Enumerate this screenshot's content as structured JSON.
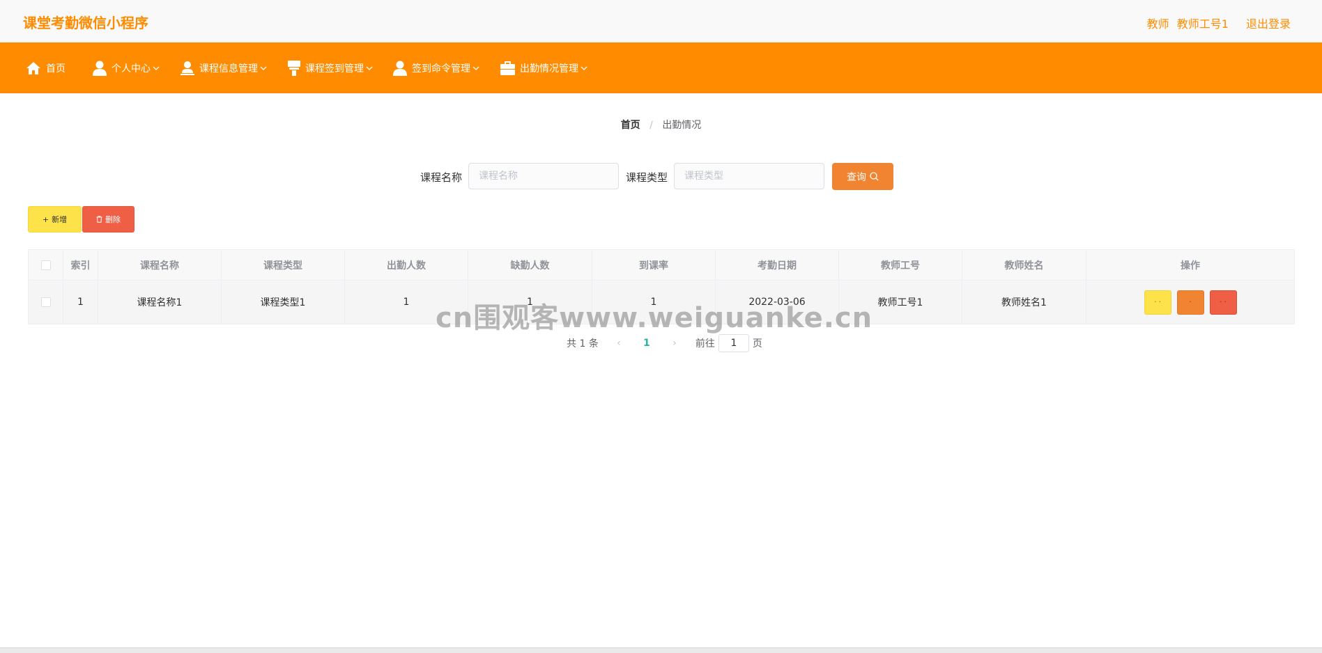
{
  "header": {
    "title": "课堂考勤微信小程序",
    "role": "教师",
    "username": "教师工号1",
    "logout_label": "退出登录"
  },
  "nav": {
    "items": [
      {
        "label": "首页",
        "icon": "home-icon"
      },
      {
        "label": "个人中心",
        "icon": "user-icon"
      },
      {
        "label": "课程信息管理",
        "icon": "user-stamp-icon"
      },
      {
        "label": "课程签到管理",
        "icon": "stamp-icon"
      },
      {
        "label": "签到命令管理",
        "icon": "user-icon"
      },
      {
        "label": "出勤情况管理",
        "icon": "briefcase-icon"
      }
    ]
  },
  "breadcrumb": {
    "home": "首页",
    "separator": "/",
    "current": "出勤情况"
  },
  "search": {
    "course_name_label": "课程名称",
    "course_name_placeholder": "课程名称",
    "course_type_label": "课程类型",
    "course_type_placeholder": "课程类型",
    "query_label": "查询"
  },
  "actions": {
    "add_label": "新增",
    "add_symbol": "+",
    "delete_label": "删除"
  },
  "table": {
    "columns": [
      "索引",
      "课程名称",
      "课程类型",
      "出勤人数",
      "缺勤人数",
      "到课率",
      "考勤日期",
      "教师工号",
      "教师姓名",
      "操作"
    ],
    "rows": [
      {
        "index": "1",
        "course_name": "课程名称1",
        "course_type": "课程类型1",
        "attendance": "1",
        "absence": "1",
        "rate": "1",
        "date": "2022-03-06",
        "teacher_id": "教师工号1",
        "teacher_name": "教师姓名1"
      }
    ],
    "op_dots": [
      "· ·",
      "·",
      "· ·"
    ]
  },
  "pagination": {
    "total_text": "共 1 条",
    "prev": "‹",
    "current_page": "1",
    "next": "›",
    "goto_label": "前往",
    "goto_value": "1",
    "page_suffix": "页"
  },
  "watermark": "cn围观客www.weiguanke.cn",
  "colors": {
    "brand": "#ff8c00",
    "query": "#f08430",
    "add": "#fde249",
    "delete": "#ee5f46",
    "page_active": "#20b7a3"
  }
}
